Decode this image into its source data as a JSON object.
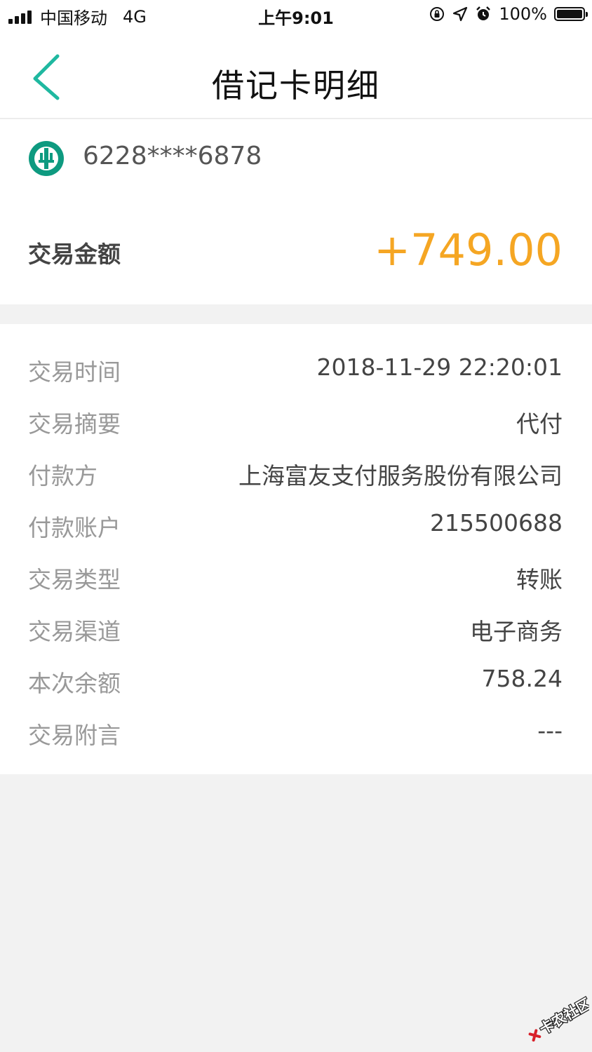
{
  "status_bar": {
    "carrier": "中国移动",
    "network": "4G",
    "time": "上午9:01",
    "battery": "100%"
  },
  "nav": {
    "title": "借记卡明细",
    "back_icon": "chevron-left-icon"
  },
  "card": {
    "number": "6228****6878",
    "logo_icon": "abc-bank-logo-icon",
    "amount_label": "交易金额",
    "amount_value": "+749.00"
  },
  "details": [
    {
      "label": "交易时间",
      "value": "2018-11-29 22:20:01"
    },
    {
      "label": "交易摘要",
      "value": "代付"
    },
    {
      "label": "付款方",
      "value": "上海富友支付服务股份有限公司"
    },
    {
      "label": "付款账户",
      "value": "215500688"
    },
    {
      "label": "交易类型",
      "value": "转账"
    },
    {
      "label": "交易渠道",
      "value": "电子商务"
    },
    {
      "label": "本次余额",
      "value": "758.24"
    },
    {
      "label": "交易附言",
      "value": "---"
    }
  ],
  "watermark": {
    "text": "卡农社区"
  },
  "colors": {
    "accent": "#1fb8a0",
    "amount": "#f5a623",
    "background": "#f2f2f2"
  }
}
